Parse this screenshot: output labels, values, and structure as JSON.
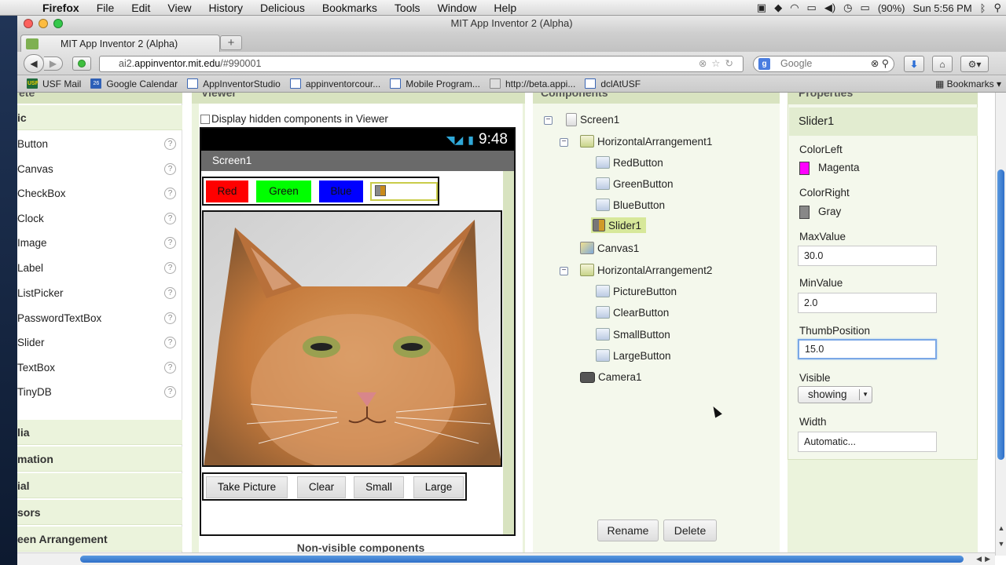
{
  "menubar": {
    "app": "Firefox",
    "items": [
      "File",
      "Edit",
      "View",
      "History",
      "Delicious",
      "Bookmarks",
      "Tools",
      "Window",
      "Help"
    ],
    "battery": "(90%)",
    "clock": "Sun 5:56 PM"
  },
  "window": {
    "title": "MIT App Inventor 2 (Alpha)",
    "tab_title": "MIT App Inventor 2 (Alpha)",
    "url_prefix": "ai2.",
    "url_domain": "appinventor.mit.edu",
    "url_path": "/#990001",
    "search_placeholder": "Google"
  },
  "bookmarks": {
    "items": [
      "USF Mail",
      "Google Calendar",
      "AppInventorStudio",
      "appinventorcour...",
      "Mobile Program...",
      "http://beta.appi...",
      "dclAtUSF"
    ],
    "menu": "Bookmarks"
  },
  "palette": {
    "header": "ete",
    "section_basic": "ic",
    "items": [
      "Button",
      "Canvas",
      "CheckBox",
      "Clock",
      "Image",
      "Label",
      "ListPicker",
      "PasswordTextBox",
      "Slider",
      "TextBox",
      "TinyDB"
    ],
    "help_glyph": "?",
    "sections": [
      "lia",
      "mation",
      "ial",
      "sors",
      "een Arrangement"
    ]
  },
  "viewer": {
    "header": "Viewer",
    "hidden_checkbox_label": "Display hidden components in Viewer",
    "clock": "9:48",
    "screen_title": "Screen1",
    "buttons_row1": {
      "red": "Red",
      "green": "Green",
      "blue": "Blue"
    },
    "buttons_row2": [
      "Take Picture",
      "Clear",
      "Small",
      "Large"
    ],
    "nonvisible_label": "Non-visible components"
  },
  "components": {
    "header": "Components",
    "tree": {
      "screen": "Screen1",
      "harr1": "HorizontalArrangement1",
      "red": "RedButton",
      "green": "GreenButton",
      "blue": "BlueButton",
      "slider": "Slider1",
      "canvas": "Canvas1",
      "harr2": "HorizontalArrangement2",
      "picture": "PictureButton",
      "clear": "ClearButton",
      "small": "SmallButton",
      "large": "LargeButton",
      "camera": "Camera1"
    },
    "rename": "Rename",
    "delete": "Delete"
  },
  "properties": {
    "header": "Properties",
    "component": "Slider1",
    "color_left_label": "ColorLeft",
    "color_left_value": "Magenta",
    "color_left_hex": "#ff00ff",
    "color_right_label": "ColorRight",
    "color_right_value": "Gray",
    "color_right_hex": "#888888",
    "max_label": "MaxValue",
    "max_value": "30.0",
    "min_label": "MinValue",
    "min_value": "2.0",
    "thumb_label": "ThumbPosition",
    "thumb_value": "15.0",
    "visible_label": "Visible",
    "visible_value": "showing",
    "width_label": "Width",
    "width_value": "Automatic..."
  }
}
